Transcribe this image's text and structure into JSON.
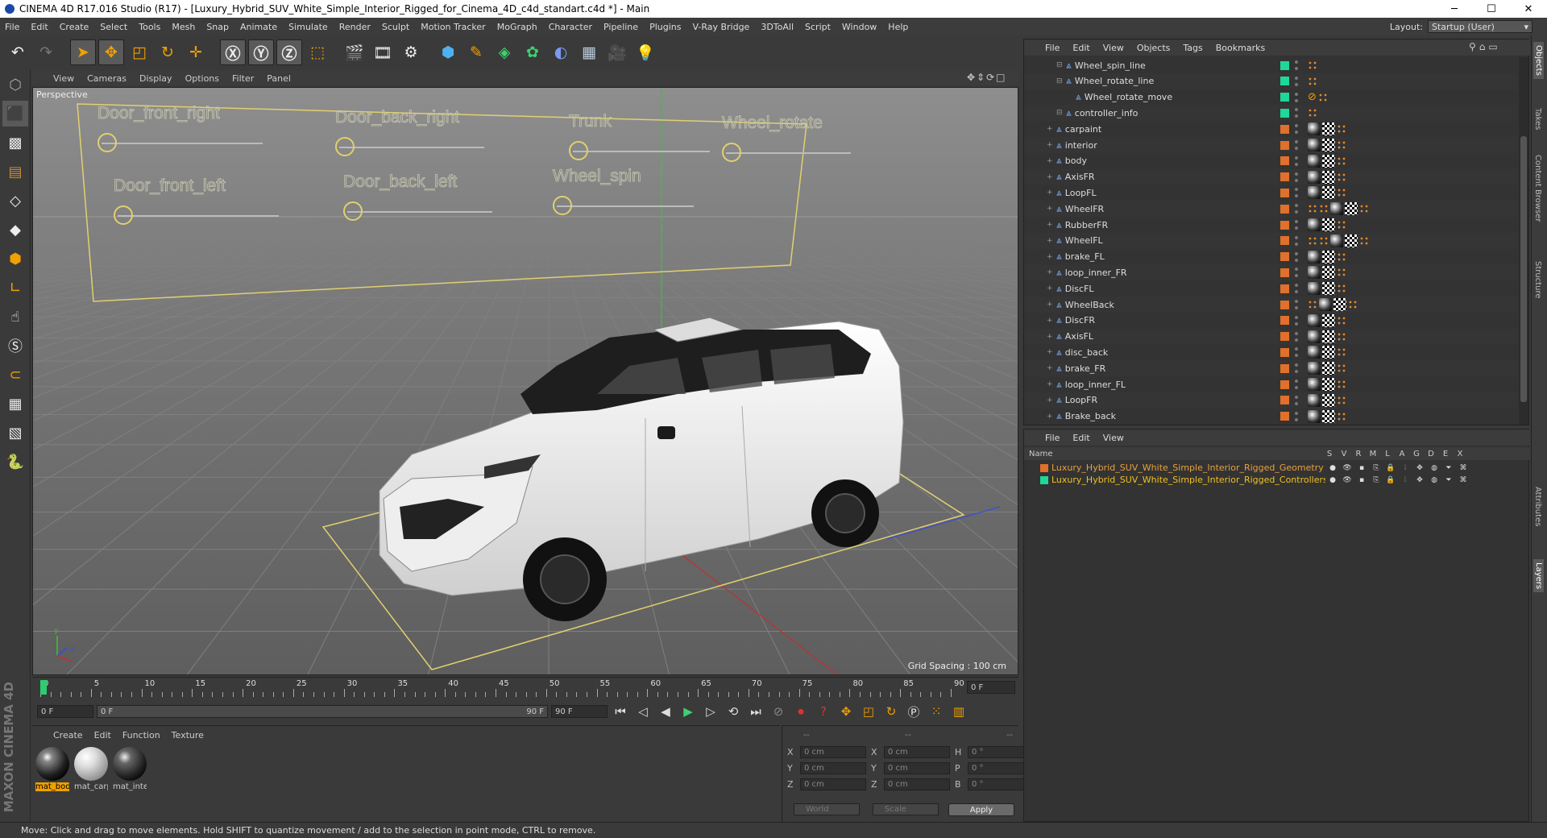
{
  "window": {
    "title": "CINEMA 4D R17.016 Studio (R17) - [Luxury_Hybrid_SUV_White_Simple_Interior_Rigged_for_Cinema_4D_c4d_standart.c4d *] - Main",
    "minimize": "─",
    "maximize": "☐",
    "close": "✕"
  },
  "menu": [
    "File",
    "Edit",
    "Create",
    "Select",
    "Tools",
    "Mesh",
    "Snap",
    "Animate",
    "Simulate",
    "Render",
    "Sculpt",
    "Motion Tracker",
    "MoGraph",
    "Character",
    "Pipeline",
    "Plugins",
    "V-Ray Bridge",
    "3DToAll",
    "Script",
    "Window",
    "Help"
  ],
  "layout": {
    "label": "Layout:",
    "value": "Startup (User)"
  },
  "viewport": {
    "menu": [
      "View",
      "Cameras",
      "Display",
      "Options",
      "Filter",
      "Panel"
    ],
    "label": "Perspective",
    "grid_spacing": "Grid Spacing : 100 cm",
    "controls": [
      "Door_front_right",
      "Door_back_right",
      "Trunk",
      "Wheel_rotate",
      "Door_front_left",
      "Door_back_left",
      "Wheel_spin"
    ]
  },
  "timeline": {
    "ticks": [
      "0",
      "5",
      "10",
      "15",
      "20",
      "25",
      "30",
      "35",
      "40",
      "45",
      "50",
      "55",
      "60",
      "65",
      "70",
      "75",
      "80",
      "85",
      "90"
    ],
    "current": "0 F",
    "start": "0 F",
    "range_start": "0 F",
    "range_end": "90 F",
    "end": "90 F"
  },
  "materials": {
    "menu": [
      "Create",
      "Edit",
      "Function",
      "Texture"
    ],
    "items": [
      "mat_body",
      "mat_carpaint",
      "mat_interior"
    ]
  },
  "coords": {
    "headers": [
      "--",
      "--",
      "--"
    ],
    "rows": [
      {
        "a": "X",
        "av": "0 cm",
        "b": "X",
        "bv": "0 cm",
        "c": "H",
        "cv": "0 °"
      },
      {
        "a": "Y",
        "av": "0 cm",
        "b": "Y",
        "bv": "0 cm",
        "c": "P",
        "cv": "0 °"
      },
      {
        "a": "Z",
        "av": "0 cm",
        "b": "Z",
        "bv": "0 cm",
        "c": "B",
        "cv": "0 °"
      }
    ],
    "world": "World",
    "scale": "Scale",
    "apply": "Apply"
  },
  "status": "Move: Click and drag to move elements. Hold SHIFT to quantize movement / add to the selection in point mode, CTRL to remove.",
  "objects": {
    "menu": [
      "File",
      "Edit",
      "View",
      "Objects",
      "Tags",
      "Bookmarks"
    ],
    "rows": [
      {
        "name": "Wheel_spin_line",
        "indent": 2,
        "color": "#1ed89a",
        "tags": "or"
      },
      {
        "name": "Wheel_rotate_line",
        "indent": 2,
        "color": "#1ed89a",
        "tags": "or"
      },
      {
        "name": "Wheel_rotate_move",
        "indent": 3,
        "color": "#1ed89a",
        "tags": "no"
      },
      {
        "name": "controller_info",
        "indent": 2,
        "color": "#1ed89a",
        "tags": "or"
      },
      {
        "name": "carpaint",
        "indent": 1,
        "color": "#e0702a",
        "tags": "std"
      },
      {
        "name": "interior",
        "indent": 1,
        "color": "#e0702a",
        "tags": "std"
      },
      {
        "name": "body",
        "indent": 1,
        "color": "#e0702a",
        "tags": "std"
      },
      {
        "name": "AxisFR",
        "indent": 1,
        "color": "#e0702a",
        "tags": "std"
      },
      {
        "name": "LoopFL",
        "indent": 1,
        "color": "#e0702a",
        "tags": "std"
      },
      {
        "name": "WheelFR",
        "indent": 1,
        "color": "#e0702a",
        "tags": "wheel"
      },
      {
        "name": "RubberFR",
        "indent": 1,
        "color": "#e0702a",
        "tags": "std"
      },
      {
        "name": "WheelFL",
        "indent": 1,
        "color": "#e0702a",
        "tags": "wheel"
      },
      {
        "name": "brake_FL",
        "indent": 1,
        "color": "#e0702a",
        "tags": "std"
      },
      {
        "name": "loop_inner_FR",
        "indent": 1,
        "color": "#e0702a",
        "tags": "std"
      },
      {
        "name": "DiscFL",
        "indent": 1,
        "color": "#e0702a",
        "tags": "std"
      },
      {
        "name": "WheelBack",
        "indent": 1,
        "color": "#e0702a",
        "tags": "wheelb"
      },
      {
        "name": "DiscFR",
        "indent": 1,
        "color": "#e0702a",
        "tags": "std"
      },
      {
        "name": "AxisFL",
        "indent": 1,
        "color": "#e0702a",
        "tags": "std"
      },
      {
        "name": "disc_back",
        "indent": 1,
        "color": "#e0702a",
        "tags": "std"
      },
      {
        "name": "brake_FR",
        "indent": 1,
        "color": "#e0702a",
        "tags": "std"
      },
      {
        "name": "loop_inner_FL",
        "indent": 1,
        "color": "#e0702a",
        "tags": "std"
      },
      {
        "name": "LoopFR",
        "indent": 1,
        "color": "#e0702a",
        "tags": "std"
      },
      {
        "name": "Brake_back",
        "indent": 1,
        "color": "#e0702a",
        "tags": "std"
      }
    ]
  },
  "layers": {
    "menu": [
      "File",
      "Edit",
      "View"
    ],
    "head_name": "Name",
    "cols": [
      "S",
      "V",
      "R",
      "M",
      "L",
      "A",
      "G",
      "D",
      "E",
      "X"
    ],
    "rows": [
      {
        "name": "Luxury_Hybrid_SUV_White_Simple_Interior_Rigged_Geometry",
        "color": "#e0702a",
        "text": "#e8a040"
      },
      {
        "name": "Luxury_Hybrid_SUV_White_Simple_Interior_Rigged_Controllers",
        "color": "#1ed89a",
        "text": "#f0c020"
      }
    ]
  },
  "sidetabs": [
    "Objects",
    "Takes",
    "Content Browser",
    "Structure",
    "Attributes",
    "Layers"
  ],
  "brand": "MAXON CINEMA 4D"
}
